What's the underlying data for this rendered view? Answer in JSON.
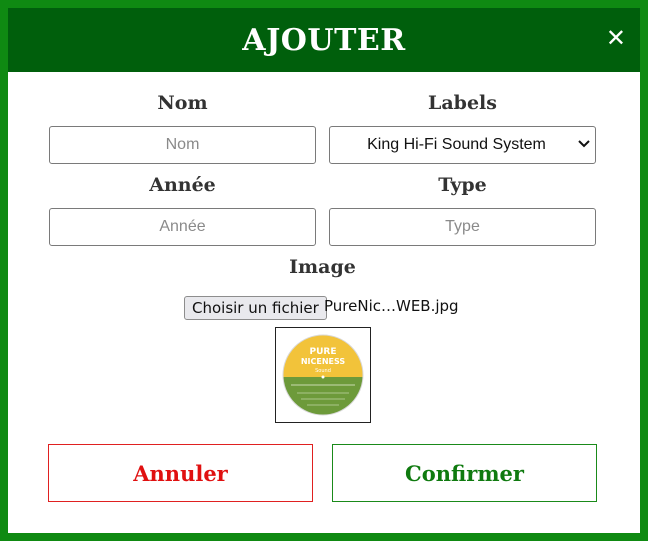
{
  "modal": {
    "title": "AJOUTER",
    "close": "✕"
  },
  "form": {
    "name_label": "Nom",
    "name_placeholder": "Nom",
    "labels_label": "Labels",
    "labels_selected": "King Hi-Fi Sound System",
    "year_label": "Année",
    "year_placeholder": "Année",
    "type_label": "Type",
    "type_placeholder": "Type",
    "image_label": "Image",
    "file_button": "Choisir un fichier",
    "file_name": "PureNic…WEB.jpg"
  },
  "preview": {
    "top_text": "PURE",
    "middle_text": "NICENESS",
    "bottom_text": "Sound"
  },
  "actions": {
    "cancel": "Annuler",
    "confirm": "Confirmer"
  },
  "colors": {
    "header": "#005f0c",
    "border": "#0f8a12",
    "cancel": "#e01010",
    "confirm": "#0f7a0f"
  }
}
